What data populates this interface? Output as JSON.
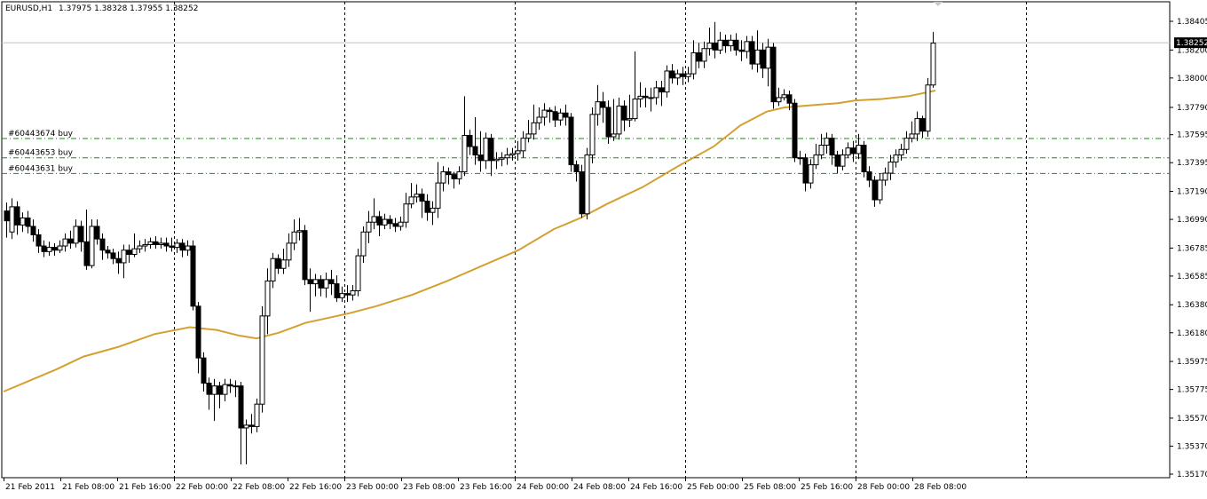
{
  "header": {
    "symbol": "EURUSD,H1",
    "ohlc": "1.37975 1.38328 1.37955 1.38252"
  },
  "colors": {
    "background": "#ffffff",
    "candle_bull_fill": "#ffffff",
    "candle_bear_fill": "#000000",
    "candle_outline": "#000000",
    "moving_average": "#d4a030",
    "order_line": "#1a8a1a",
    "grid": "#000000",
    "current_price_label_bg": "#000000",
    "current_price_line": "#c0c0c0"
  },
  "chart_data": {
    "type": "candlestick",
    "symbol": "EURUSD",
    "timeframe": "H1",
    "price_scale": [
      "1.38405",
      "1.38200",
      "1.38000",
      "1.37790",
      "1.37595",
      "1.37395",
      "1.37190",
      "1.36990",
      "1.36785",
      "1.36585",
      "1.36380",
      "1.36180",
      "1.35975",
      "1.35775",
      "1.35570",
      "1.35370",
      "1.35170"
    ],
    "current_price": "1.38252",
    "time_labels": [
      "21 Feb 2011",
      "21 Feb 08:00",
      "21 Feb 16:00",
      "22 Feb 00:00",
      "22 Feb 08:00",
      "22 Feb 16:00",
      "23 Feb 00:00",
      "23 Feb 08:00",
      "23 Feb 16:00",
      "24 Feb 00:00",
      "24 Feb 08:00",
      "24 Feb 16:00",
      "25 Feb 00:00",
      "25 Feb 08:00",
      "25 Feb 16:00",
      "28 Feb 00:00",
      "28 Feb 08:00"
    ],
    "day_separators": [
      "22 Feb 00:00",
      "23 Feb 00:00",
      "24 Feb 00:00",
      "25 Feb 00:00",
      "28 Feb 00:00"
    ],
    "ylim": [
      1.3512,
      1.3846
    ],
    "orders": [
      {
        "label": "#60443674 buy",
        "price": 1.37568
      },
      {
        "label": "#60443653 buy",
        "price": 1.3743
      },
      {
        "label": "#60443631 buy",
        "price": 1.37318
      }
    ],
    "moving_average": [
      [
        0,
        1.3576
      ],
      [
        30,
        1.3584
      ],
      [
        60,
        1.3592
      ],
      [
        90,
        1.3601
      ],
      [
        130,
        1.3608
      ],
      [
        170,
        1.3617
      ],
      [
        210,
        1.3622
      ],
      [
        240,
        1.362
      ],
      [
        265,
        1.3616
      ],
      [
        285,
        1.3614
      ],
      [
        310,
        1.3618
      ],
      [
        340,
        1.3625
      ],
      [
        390,
        1.3632
      ],
      [
        420,
        1.3637
      ],
      [
        460,
        1.3645
      ],
      [
        500,
        1.3655
      ],
      [
        540,
        1.3666
      ],
      [
        580,
        1.3677
      ],
      [
        620,
        1.3692
      ],
      [
        650,
        1.37
      ],
      [
        680,
        1.371
      ],
      [
        720,
        1.3722
      ],
      [
        760,
        1.3737
      ],
      [
        800,
        1.3751
      ],
      [
        830,
        1.3766
      ],
      [
        860,
        1.3776
      ],
      [
        880,
        1.3779
      ],
      [
        900,
        1.378
      ],
      [
        920,
        1.3781
      ],
      [
        940,
        1.3782
      ],
      [
        960,
        1.3784
      ],
      [
        990,
        1.3785
      ],
      [
        1020,
        1.3787
      ],
      [
        1050,
        1.3791
      ]
    ],
    "candles": [
      [
        3,
        1.3705,
        1.3698,
        1.3711,
        1.3686
      ],
      [
        9,
        1.369,
        1.3708,
        1.3714,
        1.3685
      ],
      [
        15,
        1.3708,
        1.3695,
        1.3712,
        1.3688
      ],
      [
        21,
        1.3695,
        1.37,
        1.3704,
        1.369
      ],
      [
        27,
        1.37,
        1.3694,
        1.3705,
        1.3689
      ],
      [
        33,
        1.3694,
        1.3688,
        1.3699,
        1.3683
      ],
      [
        39,
        1.3688,
        1.368,
        1.3692,
        1.3675
      ],
      [
        45,
        1.368,
        1.3676,
        1.3684,
        1.3672
      ],
      [
        51,
        1.3676,
        1.3679,
        1.3683,
        1.3673
      ],
      [
        57,
        1.3679,
        1.3677,
        1.3682,
        1.3673
      ],
      [
        63,
        1.3677,
        1.368,
        1.3684,
        1.3675
      ],
      [
        69,
        1.368,
        1.3685,
        1.3689,
        1.3676
      ],
      [
        75,
        1.3685,
        1.3682,
        1.3691,
        1.3678
      ],
      [
        81,
        1.3682,
        1.3694,
        1.3699,
        1.3679
      ],
      [
        87,
        1.3694,
        1.3683,
        1.3698,
        1.3676
      ],
      [
        93,
        1.3683,
        1.3666,
        1.3706,
        1.3663
      ],
      [
        99,
        1.3666,
        1.3694,
        1.3699,
        1.3664
      ],
      [
        105,
        1.3694,
        1.3685,
        1.3699,
        1.3681
      ],
      [
        111,
        1.3685,
        1.3677,
        1.3689,
        1.367
      ],
      [
        117,
        1.3677,
        1.3675,
        1.368,
        1.3671
      ],
      [
        123,
        1.3675,
        1.3671,
        1.3678,
        1.3667
      ],
      [
        129,
        1.3671,
        1.3668,
        1.3676,
        1.366
      ],
      [
        135,
        1.3668,
        1.3677,
        1.3681,
        1.3657
      ],
      [
        141,
        1.3677,
        1.3674,
        1.3681,
        1.3668
      ],
      [
        147,
        1.3674,
        1.3678,
        1.3689,
        1.3672
      ],
      [
        153,
        1.3678,
        1.368,
        1.3684,
        1.3675
      ],
      [
        159,
        1.368,
        1.3681,
        1.3685,
        1.3676
      ],
      [
        165,
        1.3681,
        1.3683,
        1.3686,
        1.3678
      ],
      [
        171,
        1.3683,
        1.3681,
        1.3687,
        1.3678
      ],
      [
        177,
        1.3681,
        1.3682,
        1.3686,
        1.3678
      ],
      [
        183,
        1.3682,
        1.368,
        1.3686,
        1.3676
      ],
      [
        189,
        1.368,
        1.3679,
        1.3686,
        1.3676
      ],
      [
        195,
        1.3679,
        1.3682,
        1.3685,
        1.3675
      ],
      [
        201,
        1.3682,
        1.3677,
        1.3685,
        1.3672
      ],
      [
        207,
        1.3677,
        1.368,
        1.3684,
        1.3673
      ],
      [
        213,
        1.368,
        1.3637,
        1.3684,
        1.3634
      ],
      [
        219,
        1.3637,
        1.36,
        1.364,
        1.3589
      ],
      [
        225,
        1.36,
        1.3582,
        1.3604,
        1.3576
      ],
      [
        231,
        1.3582,
        1.3574,
        1.3586,
        1.3563
      ],
      [
        237,
        1.3574,
        1.358,
        1.3585,
        1.3555
      ],
      [
        243,
        1.358,
        1.3574,
        1.3583,
        1.3564
      ],
      [
        249,
        1.3574,
        1.3581,
        1.3585,
        1.3569
      ],
      [
        255,
        1.3581,
        1.358,
        1.3585,
        1.3575
      ],
      [
        261,
        1.358,
        1.358,
        1.3584,
        1.3572
      ],
      [
        267,
        1.358,
        1.355,
        1.3583,
        1.3524
      ],
      [
        273,
        1.355,
        1.3552,
        1.3556,
        1.3524
      ],
      [
        279,
        1.3552,
        1.3551,
        1.356,
        1.3546
      ],
      [
        285,
        1.3551,
        1.3567,
        1.3571,
        1.3547
      ],
      [
        291,
        1.3567,
        1.363,
        1.3637,
        1.3561
      ],
      [
        297,
        1.363,
        1.3655,
        1.3664,
        1.3617
      ],
      [
        303,
        1.3655,
        1.3671,
        1.3675,
        1.365
      ],
      [
        309,
        1.3671,
        1.3664,
        1.3674,
        1.366
      ],
      [
        315,
        1.3664,
        1.367,
        1.3678,
        1.366
      ],
      [
        321,
        1.367,
        1.3682,
        1.3689,
        1.3665
      ],
      [
        327,
        1.3682,
        1.369,
        1.3699,
        1.3677
      ],
      [
        333,
        1.369,
        1.3691,
        1.37,
        1.3684
      ],
      [
        339,
        1.3691,
        1.3656,
        1.3695,
        1.3652
      ],
      [
        345,
        1.3656,
        1.3653,
        1.3664,
        1.3633
      ],
      [
        351,
        1.3653,
        1.3656,
        1.366,
        1.3644
      ],
      [
        357,
        1.3656,
        1.365,
        1.3659,
        1.3644
      ],
      [
        363,
        1.365,
        1.3656,
        1.3661,
        1.3643
      ],
      [
        369,
        1.3656,
        1.3653,
        1.3663,
        1.3645
      ],
      [
        375,
        1.3653,
        1.3643,
        1.3659,
        1.364
      ],
      [
        381,
        1.3643,
        1.3646,
        1.3651,
        1.364
      ],
      [
        387,
        1.3646,
        1.3645,
        1.3652,
        1.364
      ],
      [
        393,
        1.3645,
        1.3648,
        1.3652,
        1.3641
      ],
      [
        399,
        1.3648,
        1.3673,
        1.3678,
        1.3644
      ],
      [
        405,
        1.3673,
        1.369,
        1.3694,
        1.3668
      ],
      [
        411,
        1.369,
        1.3697,
        1.3705,
        1.3682
      ],
      [
        417,
        1.3697,
        1.3701,
        1.3714,
        1.3692
      ],
      [
        423,
        1.3701,
        1.3695,
        1.3705,
        1.3687
      ],
      [
        429,
        1.3695,
        1.3699,
        1.3703,
        1.3692
      ],
      [
        435,
        1.3699,
        1.3696,
        1.3702,
        1.3692
      ],
      [
        441,
        1.3696,
        1.3694,
        1.37,
        1.369
      ],
      [
        447,
        1.3694,
        1.3697,
        1.3701,
        1.3691
      ],
      [
        453,
        1.3697,
        1.371,
        1.3718,
        1.3693
      ],
      [
        459,
        1.371,
        1.3715,
        1.3725,
        1.3707
      ],
      [
        465,
        1.3715,
        1.3717,
        1.3724,
        1.3711
      ],
      [
        471,
        1.3717,
        1.3712,
        1.3721,
        1.37
      ],
      [
        477,
        1.3712,
        1.3704,
        1.3717,
        1.3698
      ],
      [
        483,
        1.3704,
        1.3707,
        1.3712,
        1.3695
      ],
      [
        489,
        1.3707,
        1.3725,
        1.374,
        1.37
      ],
      [
        495,
        1.3725,
        1.3733,
        1.3737,
        1.3719
      ],
      [
        501,
        1.3733,
        1.3731,
        1.3736,
        1.3724
      ],
      [
        507,
        1.3731,
        1.3728,
        1.3733,
        1.3721
      ],
      [
        513,
        1.3728,
        1.3733,
        1.3737,
        1.3724
      ],
      [
        519,
        1.3733,
        1.3759,
        1.3787,
        1.373
      ],
      [
        525,
        1.3759,
        1.3751,
        1.3763,
        1.3745
      ],
      [
        531,
        1.3751,
        1.3745,
        1.3772,
        1.3738
      ],
      [
        537,
        1.3745,
        1.3741,
        1.3762,
        1.3733
      ],
      [
        543,
        1.3741,
        1.3757,
        1.3761,
        1.3735
      ],
      [
        549,
        1.3757,
        1.3741,
        1.376,
        1.373
      ],
      [
        555,
        1.3741,
        1.3742,
        1.3747,
        1.3735
      ],
      [
        561,
        1.3742,
        1.3743,
        1.3747,
        1.3737
      ],
      [
        567,
        1.3743,
        1.3745,
        1.375,
        1.3738
      ],
      [
        573,
        1.3745,
        1.3746,
        1.375,
        1.3741
      ],
      [
        579,
        1.3746,
        1.3748,
        1.3755,
        1.3741
      ],
      [
        585,
        1.3748,
        1.3757,
        1.3762,
        1.3743
      ],
      [
        591,
        1.3757,
        1.376,
        1.377,
        1.3754
      ],
      [
        597,
        1.376,
        1.3768,
        1.3781,
        1.3756
      ],
      [
        603,
        1.3768,
        1.3772,
        1.3779,
        1.3763
      ],
      [
        609,
        1.3772,
        1.3777,
        1.3782,
        1.3766
      ],
      [
        615,
        1.3777,
        1.3776,
        1.3779,
        1.3768
      ],
      [
        621,
        1.3776,
        1.377,
        1.378,
        1.3765
      ],
      [
        627,
        1.377,
        1.3775,
        1.3778,
        1.3766
      ],
      [
        633,
        1.3775,
        1.3772,
        1.3781,
        1.3766
      ],
      [
        639,
        1.3772,
        1.3738,
        1.3775,
        1.3733
      ],
      [
        645,
        1.3738,
        1.3733,
        1.3741,
        1.3726
      ],
      [
        651,
        1.3733,
        1.3703,
        1.3738,
        1.37
      ],
      [
        657,
        1.3703,
        1.3745,
        1.375,
        1.3699
      ],
      [
        663,
        1.3745,
        1.3774,
        1.3779,
        1.3739
      ],
      [
        669,
        1.3774,
        1.3783,
        1.3795,
        1.3766
      ],
      [
        675,
        1.3783,
        1.3779,
        1.379,
        1.3768
      ],
      [
        681,
        1.3779,
        1.3758,
        1.3784,
        1.3753
      ],
      [
        687,
        1.3758,
        1.376,
        1.3785,
        1.3755
      ],
      [
        693,
        1.376,
        1.378,
        1.3786,
        1.3756
      ],
      [
        699,
        1.378,
        1.377,
        1.3784,
        1.3762
      ],
      [
        705,
        1.377,
        1.3771,
        1.3788,
        1.3765
      ],
      [
        711,
        1.3771,
        1.3785,
        1.3819,
        1.3769
      ],
      [
        717,
        1.3785,
        1.3787,
        1.3797,
        1.3779
      ],
      [
        723,
        1.3787,
        1.3786,
        1.3793,
        1.3779
      ],
      [
        729,
        1.3786,
        1.3786,
        1.3793,
        1.3776
      ],
      [
        735,
        1.3786,
        1.3793,
        1.3798,
        1.3781
      ],
      [
        741,
        1.3793,
        1.379,
        1.3798,
        1.378
      ],
      [
        747,
        1.379,
        1.3805,
        1.3809,
        1.3786
      ],
      [
        753,
        1.3805,
        1.38,
        1.381,
        1.3796
      ],
      [
        759,
        1.38,
        1.3803,
        1.3806,
        1.3795
      ],
      [
        765,
        1.3803,
        1.3801,
        1.3808,
        1.3795
      ],
      [
        771,
        1.3801,
        1.3803,
        1.3808,
        1.3797
      ],
      [
        777,
        1.3803,
        1.3818,
        1.3827,
        1.3799
      ],
      [
        783,
        1.3818,
        1.3812,
        1.3825,
        1.3807
      ],
      [
        789,
        1.3812,
        1.3821,
        1.3826,
        1.3807
      ],
      [
        795,
        1.3821,
        1.3825,
        1.3836,
        1.3816
      ],
      [
        801,
        1.3825,
        1.382,
        1.384,
        1.3814
      ],
      [
        807,
        1.382,
        1.3827,
        1.3833,
        1.3817
      ],
      [
        813,
        1.3827,
        1.3823,
        1.3831,
        1.3818
      ],
      [
        819,
        1.3823,
        1.3827,
        1.3831,
        1.3819
      ],
      [
        825,
        1.3827,
        1.382,
        1.3832,
        1.3816
      ],
      [
        831,
        1.382,
        1.3819,
        1.3827,
        1.3812
      ],
      [
        837,
        1.3819,
        1.3826,
        1.383,
        1.3814
      ],
      [
        843,
        1.3826,
        1.381,
        1.383,
        1.3806
      ],
      [
        849,
        1.381,
        1.382,
        1.3834,
        1.3804
      ],
      [
        855,
        1.382,
        1.3807,
        1.3825,
        1.38
      ],
      [
        861,
        1.3807,
        1.3822,
        1.3828,
        1.3794
      ],
      [
        867,
        1.3822,
        1.3783,
        1.3825,
        1.3778
      ],
      [
        873,
        1.3783,
        1.3786,
        1.3793,
        1.378
      ],
      [
        879,
        1.3786,
        1.3788,
        1.3792,
        1.3784
      ],
      [
        885,
        1.3788,
        1.3782,
        1.3791,
        1.3777
      ],
      [
        891,
        1.3782,
        1.3743,
        1.3785,
        1.374
      ],
      [
        897,
        1.3743,
        1.3743,
        1.3748,
        1.3738
      ],
      [
        903,
        1.3743,
        1.3725,
        1.3746,
        1.3719
      ],
      [
        909,
        1.3725,
        1.3738,
        1.3742,
        1.3721
      ],
      [
        915,
        1.3738,
        1.3745,
        1.3753,
        1.3735
      ],
      [
        921,
        1.3745,
        1.3752,
        1.376,
        1.3742
      ],
      [
        927,
        1.3752,
        1.3757,
        1.3761,
        1.3746
      ],
      [
        933,
        1.3757,
        1.3745,
        1.376,
        1.3738
      ],
      [
        939,
        1.3745,
        1.3737,
        1.3748,
        1.3732
      ],
      [
        945,
        1.3737,
        1.3745,
        1.3749,
        1.3734
      ],
      [
        951,
        1.3745,
        1.375,
        1.3754,
        1.3743
      ],
      [
        957,
        1.375,
        1.3746,
        1.3755,
        1.374
      ],
      [
        963,
        1.3746,
        1.3752,
        1.376,
        1.3742
      ],
      [
        969,
        1.3752,
        1.3733,
        1.3755,
        1.3729
      ],
      [
        975,
        1.3733,
        1.3727,
        1.3737,
        1.3722
      ],
      [
        981,
        1.3727,
        1.3713,
        1.373,
        1.3708
      ],
      [
        987,
        1.3713,
        1.3727,
        1.3732,
        1.371
      ],
      [
        993,
        1.3727,
        1.3732,
        1.3736,
        1.3723
      ],
      [
        999,
        1.3732,
        1.374,
        1.3745,
        1.3727
      ],
      [
        1005,
        1.374,
        1.3745,
        1.3749,
        1.3736
      ],
      [
        1011,
        1.3745,
        1.3749,
        1.3753,
        1.3741
      ],
      [
        1017,
        1.3749,
        1.3757,
        1.3762,
        1.3746
      ],
      [
        1023,
        1.3757,
        1.376,
        1.3769,
        1.3754
      ],
      [
        1029,
        1.376,
        1.3771,
        1.3776,
        1.3755
      ],
      [
        1035,
        1.3771,
        1.3762,
        1.3773,
        1.3757
      ],
      [
        1041,
        1.3762,
        1.3795,
        1.38,
        1.3758
      ],
      [
        1047,
        1.3795,
        1.3825,
        1.3833,
        1.3793
      ]
    ]
  }
}
